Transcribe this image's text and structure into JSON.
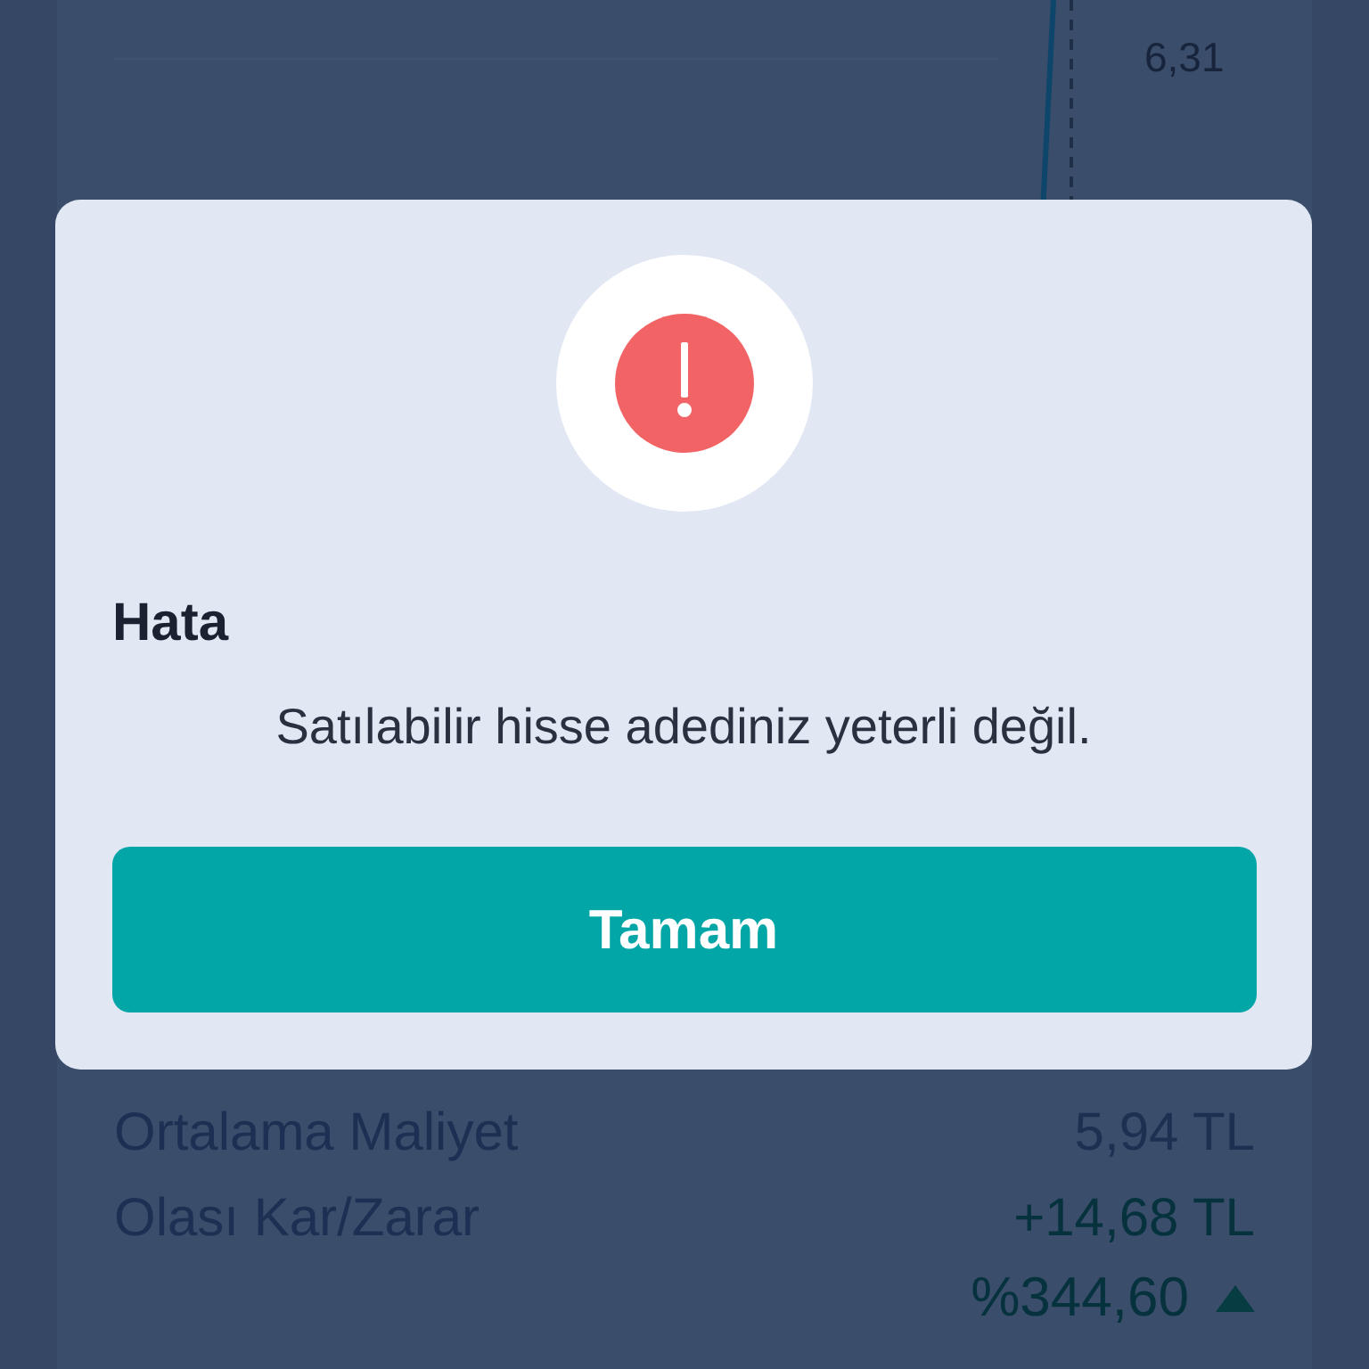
{
  "chart": {
    "price_label": "6,31"
  },
  "holdings": {
    "rows": [
      {
        "label": "Ortalama Maliyet",
        "value": "5,94 TL",
        "positive": false
      },
      {
        "label": "Olası Kar/Zarar",
        "value": "+14,68 TL",
        "positive": true
      }
    ],
    "change": {
      "value": "%344,60",
      "positive": true
    }
  },
  "dialog": {
    "kind": "error",
    "title": "Hata",
    "message": "Satılabilir hisse adediniz yeterli değil.",
    "button": "Tamam"
  }
}
